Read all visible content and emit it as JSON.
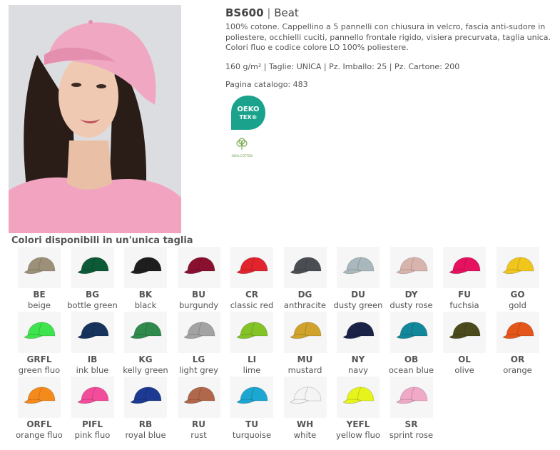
{
  "product": {
    "code": "BS600",
    "separator": "|",
    "name": "Beat",
    "description": "100% cotone. Cappellino a 5 pannelli con chiusura in velcro, fascia anti-sudore in poliestere, occhielli cuciti, pannello frontale rigido, visiera precurvata, taglia unica. Colori fluo e codice colore LO 100% poliestere.",
    "specs": "160 g/m² | Taglie: UNICA | Pz. Imballo: 25 | Pz. Cartone: 200",
    "catalog_page": "Pagina catalogo: 483"
  },
  "badges": {
    "oeko_line1": "OEKO",
    "oeko_line2": "TEX®",
    "oeko_color": "#1aa28c",
    "cotton_label": "100% COTTON"
  },
  "photo": {
    "cap_color": "#f0a7c2",
    "shirt_color": "#f2a3c0"
  },
  "colors_title": "Colori disponibili in un'unica taglia",
  "swatches": [
    {
      "code": "BE",
      "name": "beige",
      "color": "#9c9078"
    },
    {
      "code": "BG",
      "name": "bottle green",
      "color": "#0c5a36"
    },
    {
      "code": "BK",
      "name": "black",
      "color": "#1e1e1e"
    },
    {
      "code": "BU",
      "name": "burgundy",
      "color": "#8a1030"
    },
    {
      "code": "CR",
      "name": "classic red",
      "color": "#e2242e"
    },
    {
      "code": "DG",
      "name": "anthracite",
      "color": "#4a4d52"
    },
    {
      "code": "DU",
      "name": "dusty green",
      "color": "#a9b8bc"
    },
    {
      "code": "DY",
      "name": "dusty rose",
      "color": "#d8b4ad"
    },
    {
      "code": "FU",
      "name": "fuchsia",
      "color": "#e6115f"
    },
    {
      "code": "GO",
      "name": "gold",
      "color": "#f1c61c"
    },
    {
      "code": "GRFL",
      "name": "green fluo",
      "color": "#3ee34d"
    },
    {
      "code": "IB",
      "name": "ink blue",
      "color": "#15335c"
    },
    {
      "code": "KG",
      "name": "kelly green",
      "color": "#2f8a4c"
    },
    {
      "code": "LG",
      "name": "light grey",
      "color": "#a3a3a3"
    },
    {
      "code": "LI",
      "name": "lime",
      "color": "#84c326"
    },
    {
      "code": "MU",
      "name": "mustard",
      "color": "#d0a32d"
    },
    {
      "code": "NY",
      "name": "navy",
      "color": "#1a2248"
    },
    {
      "code": "OB",
      "name": "ocean blue",
      "color": "#12889a"
    },
    {
      "code": "OL",
      "name": "olive",
      "color": "#4a4a1c"
    },
    {
      "code": "OR",
      "name": "orange",
      "color": "#e4561a"
    },
    {
      "code": "ORFL",
      "name": "orange fluo",
      "color": "#f58a1c"
    },
    {
      "code": "PIFL",
      "name": "pink fluo",
      "color": "#f24c9a"
    },
    {
      "code": "RB",
      "name": "royal blue",
      "color": "#1c3a92"
    },
    {
      "code": "RU",
      "name": "rust",
      "color": "#b0674a"
    },
    {
      "code": "TU",
      "name": "turquoise",
      "color": "#1ca6d2"
    },
    {
      "code": "WH",
      "name": "white",
      "color": "#f4f4f4"
    },
    {
      "code": "YEFL",
      "name": "yellow fluo",
      "color": "#e6f41c"
    },
    {
      "code": "SR",
      "name": "sprint rose",
      "color": "#f0a9c6"
    }
  ]
}
